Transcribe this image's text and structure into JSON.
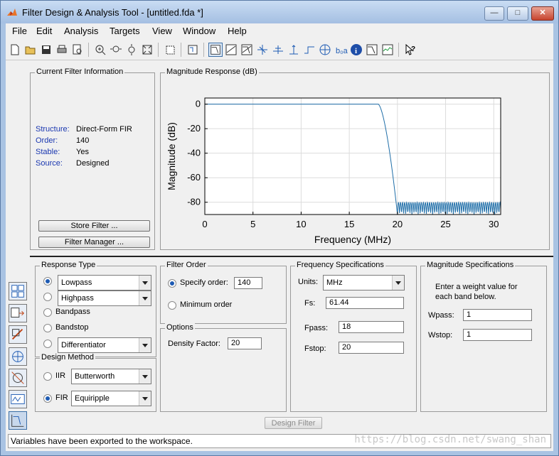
{
  "window": {
    "title": "Filter Design & Analysis Tool -  [untitled.fda *]",
    "minimize_label": "—",
    "maximize_label": "□",
    "close_label": "✕"
  },
  "menu": [
    "File",
    "Edit",
    "Analysis",
    "Targets",
    "View",
    "Window",
    "Help"
  ],
  "toolbar_icons": [
    "new-icon",
    "open-icon",
    "save-icon",
    "print-icon",
    "print-preview-icon",
    "zoom-in-icon",
    "zoom-x-icon",
    "zoom-y-icon",
    "full-view-icon",
    "new-figure-icon",
    "filter-specs-icon",
    "magnitude-response-icon",
    "phase-response-icon",
    "magnitude-phase-icon",
    "group-delay-icon",
    "phase-delay-icon",
    "impulse-response-icon",
    "step-response-icon",
    "pole-zero-icon",
    "coefficients-icon",
    "filter-info-icon",
    "magnitude-estimate-icon",
    "round-off-noise-icon",
    "whats-this-icon"
  ],
  "current_filter": {
    "title": "Current Filter Information",
    "structure_label": "Structure:",
    "structure_value": "Direct-Form FIR",
    "order_label": "Order:",
    "order_value": "140",
    "stable_label": "Stable:",
    "stable_value": "Yes",
    "source_label": "Source:",
    "source_value": "Designed",
    "store_button": "Store Filter ...",
    "manager_button": "Filter Manager ..."
  },
  "plot_panel_title": "Magnitude Response (dB)",
  "chart_data": {
    "type": "line",
    "title": "",
    "xlabel": "Frequency (MHz)",
    "ylabel": "Magnitude (dB)",
    "xlim": [
      0,
      30.72
    ],
    "ylim": [
      -90,
      5
    ],
    "xticks": [
      0,
      5,
      10,
      15,
      20,
      25,
      30
    ],
    "yticks": [
      0,
      -20,
      -40,
      -60,
      -80
    ],
    "grid": true,
    "series": [
      {
        "color": "#1f6ea8",
        "passband_edge": 18.0,
        "stopband_edge": 20.0,
        "passband_level_db": 0,
        "stopband_min_db": -90,
        "stopband_max_db": -80
      }
    ]
  },
  "response_type": {
    "title": "Response Type",
    "lowpass": "Lowpass",
    "highpass": "Highpass",
    "bandpass": "Bandpass",
    "bandstop": "Bandstop",
    "differentiator": "Differentiator",
    "selected": "Lowpass"
  },
  "design_method": {
    "title": "Design Method",
    "iir_label": "IIR",
    "iir_value": "Butterworth",
    "fir_label": "FIR",
    "fir_value": "Equiripple",
    "selected": "FIR"
  },
  "filter_order": {
    "title": "Filter Order",
    "specify_label": "Specify order:",
    "specify_value": "140",
    "minimum_label": "Minimum order"
  },
  "options": {
    "title": "Options",
    "density_label": "Density Factor:",
    "density_value": "20"
  },
  "freq_specs": {
    "title": "Frequency Specifications",
    "units_label": "Units:",
    "units_value": "MHz",
    "fs_label": "Fs:",
    "fs_value": "61.44",
    "fpass_label": "Fpass:",
    "fpass_value": "18",
    "fstop_label": "Fstop:",
    "fstop_value": "20"
  },
  "mag_specs": {
    "title": "Magnitude Specifications",
    "help_line1": "Enter a weight value for",
    "help_line2": "each band below.",
    "wpass_label": "Wpass:",
    "wpass_value": "1",
    "wstop_label": "Wstop:",
    "wstop_value": "1"
  },
  "design_button": "Design Filter",
  "status": "Variables have been exported to the workspace.",
  "watermark": "https://blog.csdn.net/swang_shan"
}
